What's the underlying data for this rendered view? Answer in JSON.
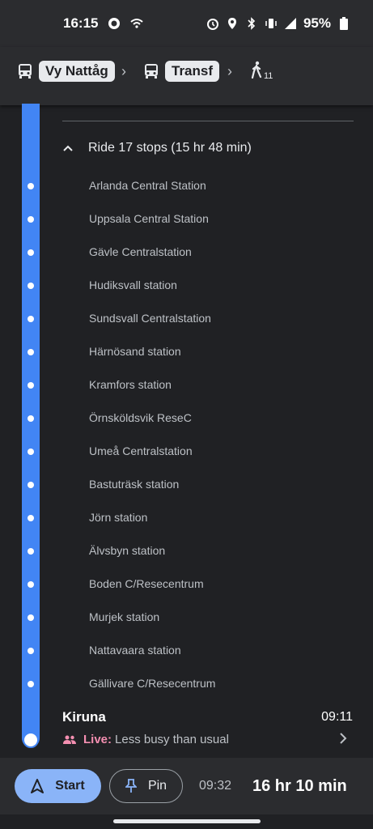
{
  "status_bar": {
    "time": "16:15",
    "battery": "95%",
    "network": "4G",
    "icons": [
      "record-icon",
      "wifi-icon",
      "alarm-icon",
      "location-icon",
      "bluetooth-icon",
      "vibrate-icon",
      "signal-icon",
      "battery-icon"
    ]
  },
  "route_steps": [
    {
      "icon": "bus-icon",
      "label": "Vy Nattåg"
    },
    {
      "icon": "bus-icon",
      "label": "Transf"
    },
    {
      "icon": "walk-icon",
      "label": "11"
    }
  ],
  "ride": {
    "header": "Ride 17 stops (15 hr 48 min)",
    "stops": [
      "Arlanda Central Station",
      "Uppsala Central Station",
      "Gävle Centralstation",
      "Hudiksvall station",
      "Sundsvall Centralstation",
      "Härnösand station",
      "Kramfors station",
      "Örnsköldsvik ReseC",
      "Umeå Centralstation",
      "Bastuträsk station",
      "Jörn station",
      "Älvsbyn station",
      "Boden C/Resecentrum",
      "Murjek station",
      "Nattavaara station",
      "Gällivare C/Resecentrum"
    ]
  },
  "destination": {
    "name": "Kiruna",
    "time": "09:11",
    "live_label": "Live:",
    "live_text": "Less busy than usual"
  },
  "bottom": {
    "start_label": "Start",
    "pin_label": "Pin",
    "eta": "09:32",
    "duration": "16 hr 10 min"
  },
  "colors": {
    "accent": "#8ab4f8",
    "timeline": "#4285f4",
    "live": "#f48fb1",
    "background": "#202124"
  }
}
